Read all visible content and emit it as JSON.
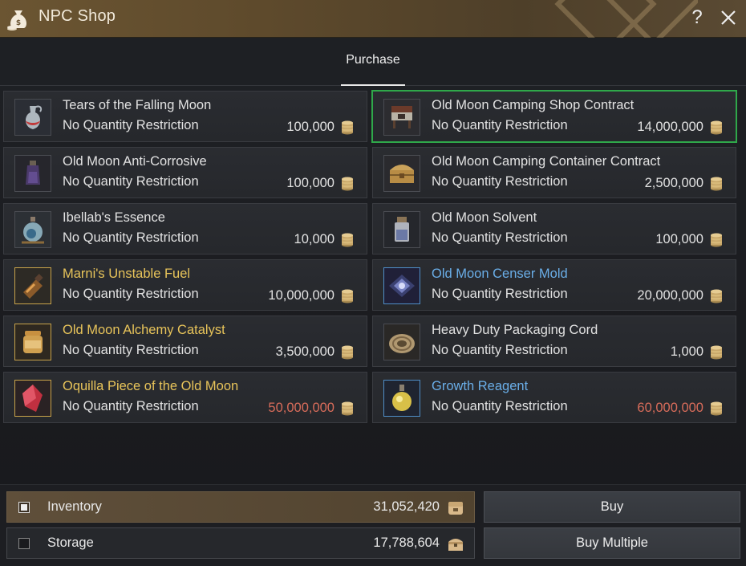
{
  "window": {
    "title": "NPC Shop",
    "help_label": "?"
  },
  "tabs": [
    {
      "label": "Purchase",
      "active": true
    }
  ],
  "items": [
    {
      "name": "Tears of the Falling Moon",
      "qty": "No Quantity Restriction",
      "price": "100,000",
      "name_color": "white",
      "price_color": "white",
      "icon": "potion-flask-icon"
    },
    {
      "name": "Old Moon Camping Shop Contract",
      "qty": "No Quantity Restriction",
      "price": "14,000,000",
      "name_color": "white",
      "price_color": "white",
      "icon": "shop-stall-icon",
      "selected": true
    },
    {
      "name": "Old Moon Anti-Corrosive",
      "qty": "No Quantity Restriction",
      "price": "100,000",
      "name_color": "white",
      "price_color": "white",
      "icon": "dark-bottle-icon"
    },
    {
      "name": "Old Moon Camping Container Contract",
      "qty": "No Quantity Restriction",
      "price": "2,500,000",
      "name_color": "white",
      "price_color": "white",
      "icon": "chest-icon"
    },
    {
      "name": "Ibellab's Essence",
      "qty": "No Quantity Restriction",
      "price": "10,000",
      "name_color": "white",
      "price_color": "white",
      "icon": "essence-flask-icon"
    },
    {
      "name": "Old Moon Solvent",
      "qty": "No Quantity Restriction",
      "price": "100,000",
      "name_color": "white",
      "price_color": "white",
      "icon": "solvent-jar-icon"
    },
    {
      "name": "Marni's Unstable Fuel",
      "qty": "No Quantity Restriction",
      "price": "10,000,000",
      "name_color": "gold",
      "price_color": "white",
      "icon": "fuel-bottle-icon"
    },
    {
      "name": "Old Moon Censer Mold",
      "qty": "No Quantity Restriction",
      "price": "20,000,000",
      "name_color": "blue",
      "price_color": "white",
      "icon": "mold-plate-icon"
    },
    {
      "name": "Old Moon Alchemy Catalyst",
      "qty": "No Quantity Restriction",
      "price": "3,500,000",
      "name_color": "gold",
      "price_color": "white",
      "icon": "catalyst-jar-icon"
    },
    {
      "name": "Heavy Duty Packaging Cord",
      "qty": "No Quantity Restriction",
      "price": "1,000",
      "name_color": "white",
      "price_color": "white",
      "icon": "rope-coil-icon"
    },
    {
      "name": "Oquilla Piece of the Old Moon",
      "qty": "No Quantity Restriction",
      "price": "50,000,000",
      "name_color": "gold",
      "price_color": "red",
      "icon": "red-crystal-icon"
    },
    {
      "name": "Growth Reagent",
      "qty": "No Quantity Restriction",
      "price": "60,000,000",
      "name_color": "blue",
      "price_color": "red",
      "icon": "reagent-flask-icon"
    }
  ],
  "wallets": [
    {
      "label": "Inventory",
      "amount": "31,052,420",
      "active": true,
      "icon": "inventory-bag-icon"
    },
    {
      "label": "Storage",
      "amount": "17,788,604",
      "active": false,
      "icon": "storage-chest-icon"
    }
  ],
  "buttons": {
    "buy": "Buy",
    "buy_multiple": "Buy Multiple"
  },
  "colors": {
    "selection": "#2fa84a",
    "gold_name": "#e8c45a",
    "blue_name": "#6aaee8",
    "red_price": "#d86c5a"
  }
}
